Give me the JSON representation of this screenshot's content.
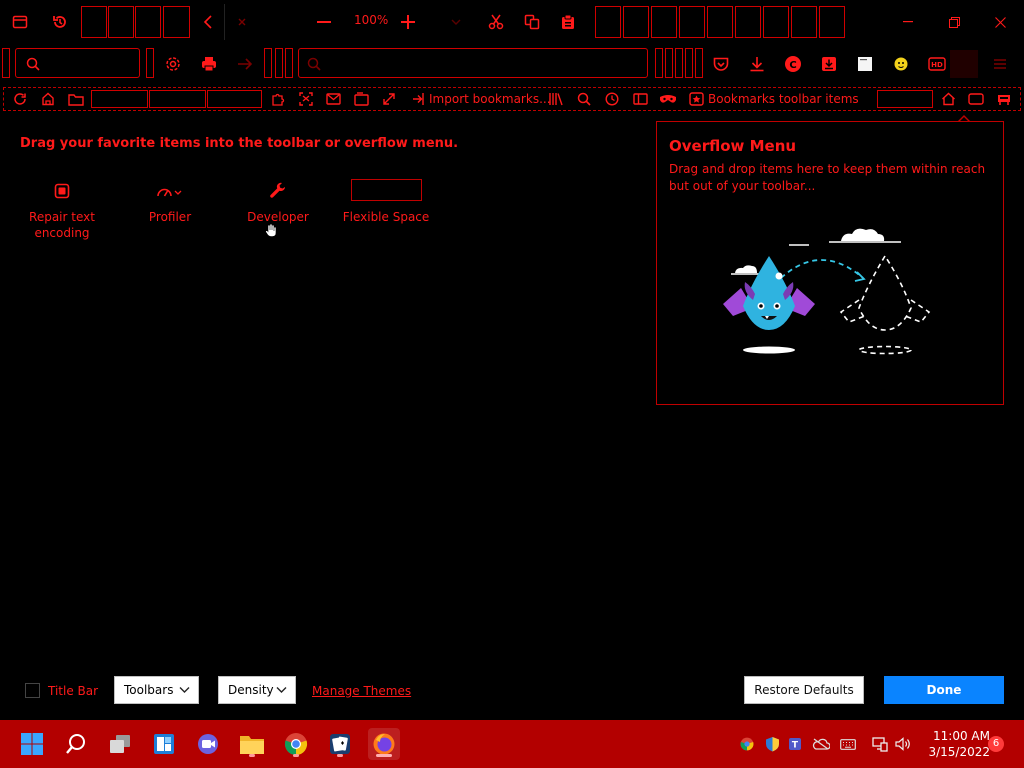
{
  "toolbar": {
    "zoom_value": "100%",
    "import_bookmarks": "Import bookmarks...",
    "bookmarks_toolbar_items": "Bookmarks toolbar items"
  },
  "main": {
    "instruction": "Drag your favorite items into the toolbar or overflow menu.",
    "palette": [
      {
        "label": "Repair text encoding",
        "icon": "repair-text-encoding-icon"
      },
      {
        "label": "Profiler",
        "icon": "profiler-icon"
      },
      {
        "label": "Developer",
        "icon": "wrench-icon"
      },
      {
        "label": "Flexible Space",
        "icon": "flexible-space-box"
      }
    ]
  },
  "overflow": {
    "title": "Overflow Menu",
    "description": "Drag and drop items here to keep them within reach but out of your toolbar..."
  },
  "footer": {
    "title_bar_label": "Title Bar",
    "title_bar_checked": false,
    "toolbars_label": "Toolbars",
    "density_label": "Density",
    "manage_themes": "Manage Themes",
    "restore_defaults": "Restore Defaults",
    "done": "Done"
  },
  "taskbar": {
    "time": "11:00 AM",
    "date": "3/15/2022",
    "notification_count": "6"
  },
  "colors": {
    "accent_red": "#ff1a1a",
    "done_blue": "#0a84ff",
    "taskbar_bg": "#b30000"
  }
}
